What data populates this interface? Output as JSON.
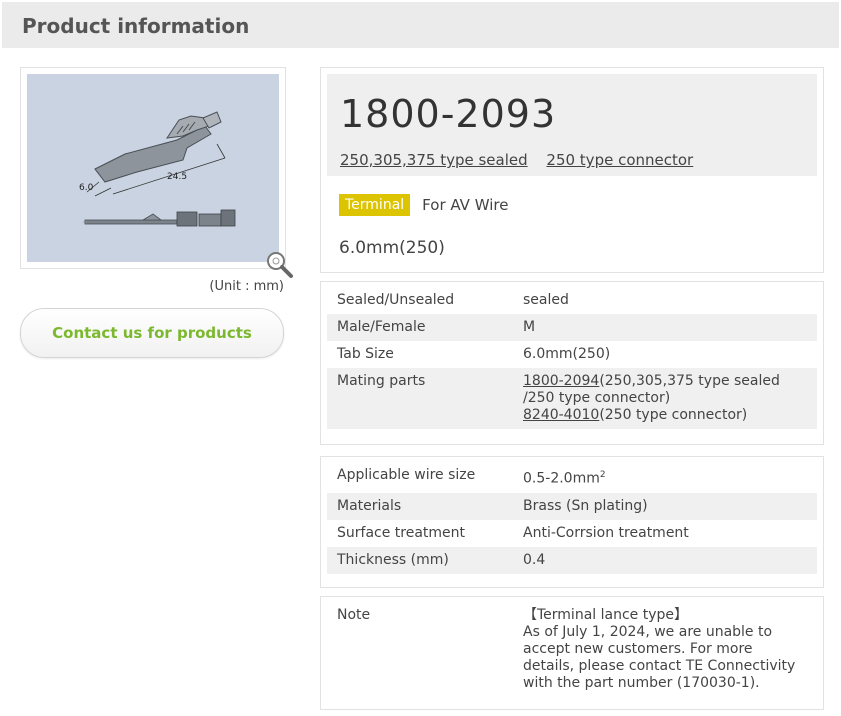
{
  "header": {
    "title": "Product information"
  },
  "image": {
    "alt": "1800-2093 terminal drawing",
    "dim_width": "6.0",
    "dim_length": "24.5"
  },
  "unit_note": "(Unit : mm)",
  "contact_button": "Contact us for products",
  "product": {
    "id": "1800-2093",
    "series": [
      "250,305,375 type sealed",
      "250 type connector"
    ],
    "tag": "Terminal",
    "tag_desc": "For AV Wire",
    "size": "6.0mm(250)"
  },
  "specs1": [
    {
      "label": "Sealed/Unsealed",
      "value": "sealed"
    },
    {
      "label": "Male/Female",
      "value": "M"
    },
    {
      "label": "Tab Size",
      "value": "6.0mm(250)"
    },
    {
      "label": "Mating parts",
      "part1": "1800-2094",
      "part1_desc": "(250,305,375 type sealed /250 type connector)",
      "part2": "8240-4010",
      "part2_desc": "(250 type connector)"
    }
  ],
  "specs2": [
    {
      "label": "Applicable wire size",
      "value": "0.5-2.0mm",
      "sup": "2"
    },
    {
      "label": "Materials",
      "value": "Brass (Sn plating)"
    },
    {
      "label": "Surface treatment",
      "value": "Anti-Corrsion treatment"
    },
    {
      "label": "Thickness (mm)",
      "value": "0.4"
    }
  ],
  "note": {
    "label": "Note",
    "line1": "【Terminal lance type】",
    "text": "As of July 1, 2024, we are unable to accept new customers. For more details, please contact TE Connectivity with the part number (170030-1)."
  },
  "colors": {
    "tag": "#ddc400",
    "contact": "#7cb82f",
    "header_bg": "#ebebeb"
  },
  "icons": [
    "zoom-in-icon"
  ]
}
